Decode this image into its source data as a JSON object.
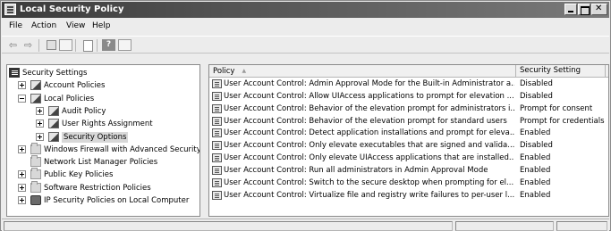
{
  "window": {
    "title": "Local Security Policy"
  },
  "menu": [
    "File",
    "Action",
    "View",
    "Help"
  ],
  "toolbar": {
    "back_icon": "back-arrow-icon",
    "forward_icon": "forward-arrow-icon",
    "back_glyph": "⇦",
    "forward_glyph": "⇨",
    "help_glyph": "?"
  },
  "tree": [
    {
      "label": "Security Settings",
      "icon": "root",
      "expander": "none",
      "indent": 0
    },
    {
      "label": "Account Policies",
      "icon": "policy",
      "expander": "plus",
      "indent": 1
    },
    {
      "label": "Local Policies",
      "icon": "policy",
      "expander": "minus",
      "indent": 1
    },
    {
      "label": "Audit Policy",
      "icon": "policy",
      "expander": "plus",
      "indent": 2
    },
    {
      "label": "User Rights Assignment",
      "icon": "policy",
      "expander": "plus",
      "indent": 2
    },
    {
      "label": "Security Options",
      "icon": "policy",
      "expander": "plus",
      "indent": 2,
      "selected": true
    },
    {
      "label": "Windows Firewall with Advanced Security",
      "icon": "folder",
      "expander": "plus",
      "indent": 1
    },
    {
      "label": "Network List Manager Policies",
      "icon": "folder",
      "expander": "none",
      "indent": 1
    },
    {
      "label": "Public Key Policies",
      "icon": "folder",
      "expander": "plus",
      "indent": 1
    },
    {
      "label": "Software Restriction Policies",
      "icon": "folder",
      "expander": "plus",
      "indent": 1
    },
    {
      "label": "IP Security Policies on Local Computer",
      "icon": "ipsec",
      "expander": "plus",
      "indent": 1
    }
  ],
  "list": {
    "columns": [
      "Policy",
      "Security Setting"
    ],
    "rows": [
      {
        "policy": "User Account Control: Admin Approval Mode for the Built-in Administrator a...",
        "setting": "Disabled"
      },
      {
        "policy": "User Account Control: Allow UIAccess applications to prompt for elevation ...",
        "setting": "Disabled"
      },
      {
        "policy": "User Account Control: Behavior of the elevation prompt for administrators i...",
        "setting": "Prompt for consent"
      },
      {
        "policy": "User Account Control: Behavior of the elevation prompt for standard users",
        "setting": "Prompt for credentials"
      },
      {
        "policy": "User Account Control: Detect application installations and prompt for eleva...",
        "setting": "Enabled"
      },
      {
        "policy": "User Account Control: Only elevate executables that are signed and valida...",
        "setting": "Disabled"
      },
      {
        "policy": "User Account Control: Only elevate UIAccess applications that are installed...",
        "setting": "Enabled"
      },
      {
        "policy": "User Account Control: Run all administrators in Admin Approval Mode",
        "setting": "Enabled"
      },
      {
        "policy": "User Account Control: Switch to the secure desktop when prompting for el...",
        "setting": "Enabled"
      },
      {
        "policy": "User Account Control: Virtualize file and registry write failures to per-user l...",
        "setting": "Enabled"
      }
    ]
  }
}
